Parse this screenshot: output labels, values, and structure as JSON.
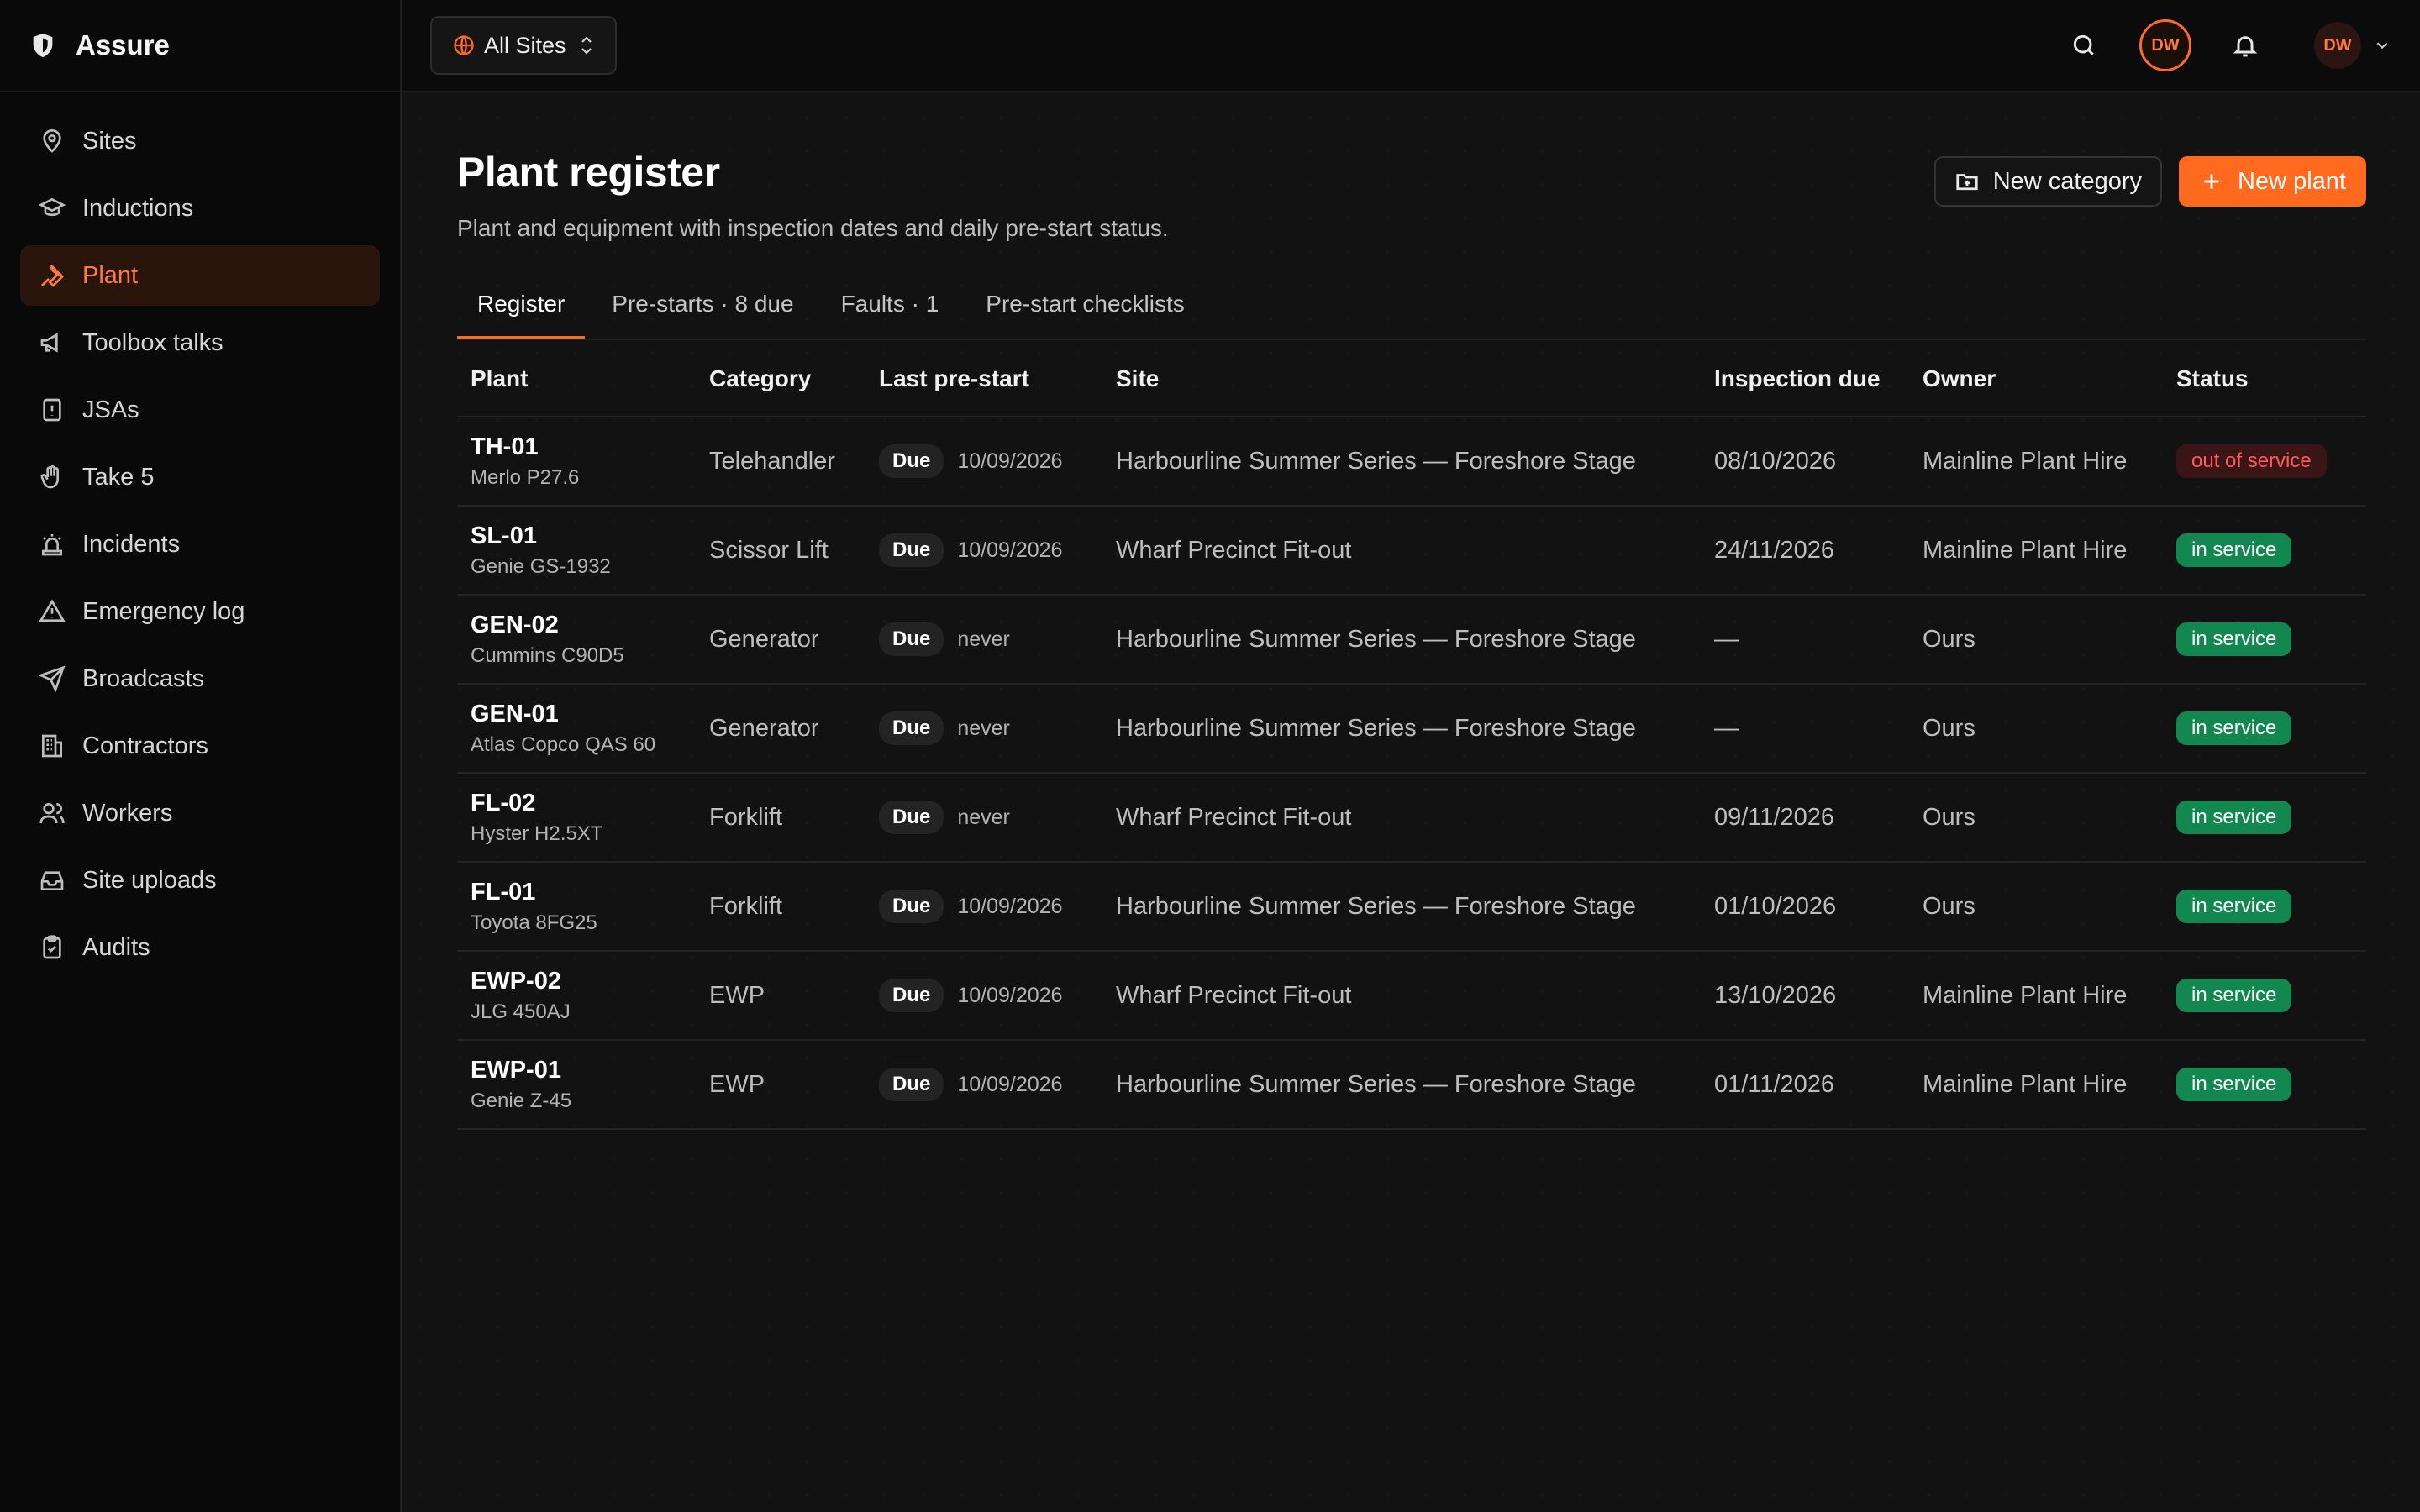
{
  "app": {
    "name": "Assure"
  },
  "sidebar": {
    "items": [
      {
        "label": "Sites",
        "icon": "map-pin-icon"
      },
      {
        "label": "Inductions",
        "icon": "graduation-cap-icon"
      },
      {
        "label": "Plant",
        "icon": "wrench-icon",
        "active": true
      },
      {
        "label": "Toolbox talks",
        "icon": "megaphone-icon"
      },
      {
        "label": "JSAs",
        "icon": "file-alert-icon"
      },
      {
        "label": "Take 5",
        "icon": "hand-icon"
      },
      {
        "label": "Incidents",
        "icon": "siren-icon"
      },
      {
        "label": "Emergency log",
        "icon": "warning-triangle-icon"
      },
      {
        "label": "Broadcasts",
        "icon": "send-icon"
      },
      {
        "label": "Contractors",
        "icon": "building-icon"
      },
      {
        "label": "Workers",
        "icon": "users-icon"
      },
      {
        "label": "Site uploads",
        "icon": "inbox-icon"
      },
      {
        "label": "Audits",
        "icon": "clipboard-check-icon"
      }
    ]
  },
  "topbar": {
    "site_select": "All Sites",
    "avatar_initials": "DW",
    "user_initials": "DW"
  },
  "page": {
    "title": "Plant register",
    "subtitle": "Plant and equipment with inspection dates and daily pre-start status.",
    "new_category": "New category",
    "new_plant": "New plant"
  },
  "tabs": [
    {
      "label": "Register",
      "active": true
    },
    {
      "label": "Pre-starts · 8 due"
    },
    {
      "label": "Faults · 1"
    },
    {
      "label": "Pre-start checklists"
    }
  ],
  "table": {
    "headers": [
      "Plant",
      "Category",
      "Last pre-start",
      "Site",
      "Inspection due",
      "Owner",
      "Status"
    ],
    "rows": [
      {
        "id": "TH-01",
        "model": "Merlo P27.6",
        "category": "Telehandler",
        "prestart_badge": "Due",
        "prestart_date": "10/09/2026",
        "site": "Harbourline Summer Series — Foreshore Stage",
        "inspection": "08/10/2026",
        "owner": "Mainline Plant Hire",
        "status": "out of service",
        "status_kind": "bad"
      },
      {
        "id": "SL-01",
        "model": "Genie GS-1932",
        "category": "Scissor Lift",
        "prestart_badge": "Due",
        "prestart_date": "10/09/2026",
        "site": "Wharf Precinct Fit-out",
        "inspection": "24/11/2026",
        "owner": "Mainline Plant Hire",
        "status": "in service",
        "status_kind": "ok"
      },
      {
        "id": "GEN-02",
        "model": "Cummins C90D5",
        "category": "Generator",
        "prestart_badge": "Due",
        "prestart_date": "never",
        "site": "Harbourline Summer Series — Foreshore Stage",
        "inspection": "—",
        "owner": "Ours",
        "status": "in service",
        "status_kind": "ok"
      },
      {
        "id": "GEN-01",
        "model": "Atlas Copco QAS 60",
        "category": "Generator",
        "prestart_badge": "Due",
        "prestart_date": "never",
        "site": "Harbourline Summer Series — Foreshore Stage",
        "inspection": "—",
        "owner": "Ours",
        "status": "in service",
        "status_kind": "ok"
      },
      {
        "id": "FL-02",
        "model": "Hyster H2.5XT",
        "category": "Forklift",
        "prestart_badge": "Due",
        "prestart_date": "never",
        "site": "Wharf Precinct Fit-out",
        "inspection": "09/11/2026",
        "owner": "Ours",
        "status": "in service",
        "status_kind": "ok"
      },
      {
        "id": "FL-01",
        "model": "Toyota 8FG25",
        "category": "Forklift",
        "prestart_badge": "Due",
        "prestart_date": "10/09/2026",
        "site": "Harbourline Summer Series — Foreshore Stage",
        "inspection": "01/10/2026",
        "owner": "Ours",
        "status": "in service",
        "status_kind": "ok"
      },
      {
        "id": "EWP-02",
        "model": "JLG 450AJ",
        "category": "EWP",
        "prestart_badge": "Due",
        "prestart_date": "10/09/2026",
        "site": "Wharf Precinct Fit-out",
        "inspection": "13/10/2026",
        "owner": "Mainline Plant Hire",
        "status": "in service",
        "status_kind": "ok"
      },
      {
        "id": "EWP-01",
        "model": "Genie Z-45",
        "category": "EWP",
        "prestart_badge": "Due",
        "prestart_date": "10/09/2026",
        "site": "Harbourline Summer Series — Foreshore Stage",
        "inspection": "01/11/2026",
        "owner": "Mainline Plant Hire",
        "status": "in service",
        "status_kind": "ok"
      }
    ]
  },
  "colors": {
    "accent": "#ff6a1f",
    "active_bg": "#2a150c",
    "ok": "#12874f",
    "bad_text": "#ff5a5a"
  }
}
